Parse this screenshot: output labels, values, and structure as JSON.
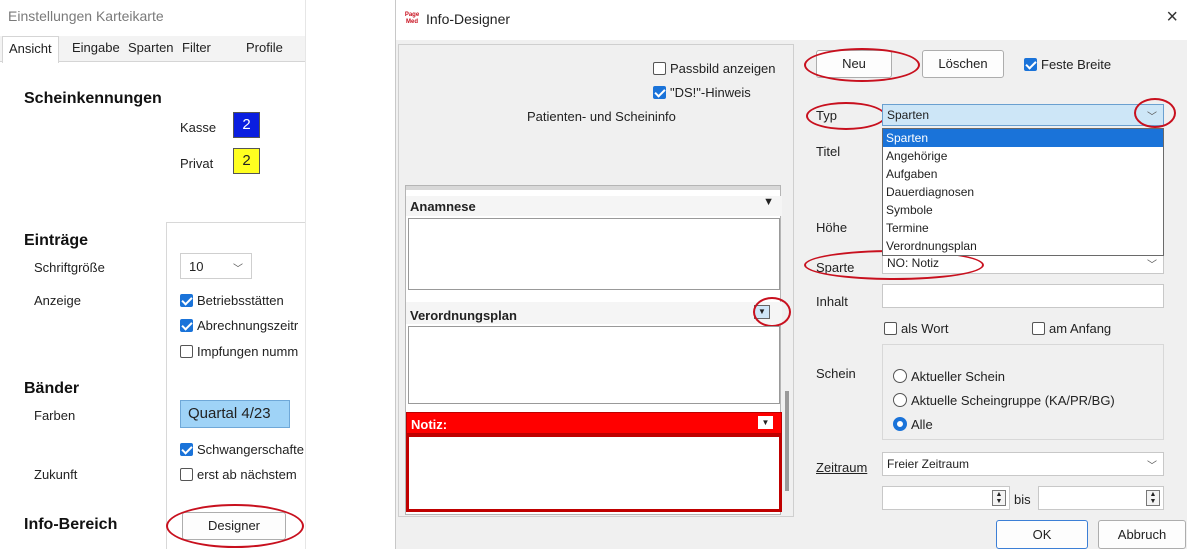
{
  "left_panel": {
    "title": "Einstellungen Karteikarte",
    "tabs": [
      "Ansicht",
      "Eingabe",
      "Sparten",
      "Filter",
      "Profile"
    ],
    "scheinkennungen": {
      "heading": "Scheinkennungen",
      "kasse_label": "Kasse",
      "kasse_value": "2",
      "kasse_color": "#0a1ee0",
      "privat_label": "Privat",
      "privat_value": "2",
      "privat_color": "#ffff20"
    },
    "eintraege": {
      "heading": "Einträge",
      "schriftgroesse_label": "Schriftgröße",
      "schriftgroesse_value": "10",
      "anzeige_label": "Anzeige",
      "options": [
        {
          "label": "Betriebsstätten",
          "checked": true
        },
        {
          "label": "Abrechnungszeitr",
          "checked": true
        },
        {
          "label": "Impfungen numm",
          "checked": false
        }
      ]
    },
    "baender": {
      "heading": "Bänder",
      "farben_label": "Farben",
      "quartal_label": "Quartal 4/23",
      "schwanger_label": "Schwangerschafte",
      "zukunft_label": "Zukunft",
      "erst_label": "erst ab nächstem"
    },
    "info_bereich": {
      "heading": "Info-Bereich",
      "designer_button": "Designer"
    }
  },
  "dialog": {
    "title": "Info-Designer",
    "app_icon_text": "Page Med",
    "close_symbol": "×",
    "preview": {
      "passbild_label": "Passbild anzeigen",
      "ds_label": "\"DS!\"-Hinweis",
      "patienten_label": "Patienten- und Scheininfo",
      "sections": [
        "Anamnese",
        "Verordnungsplan",
        "Notiz:"
      ],
      "notiz_color": "#ff0000"
    },
    "toolbar": {
      "neu": "Neu",
      "loeschen": "Löschen",
      "feste_breite": "Feste Breite"
    },
    "form": {
      "typ_label": "Typ",
      "typ_value": "Sparten",
      "typ_options": [
        "Sparten",
        "Angehörige",
        "Aufgaben",
        "Dauerdiagnosen",
        "Symbole",
        "Termine",
        "Verordnungsplan"
      ],
      "titel_label": "Titel",
      "hoehe_label": "Höhe",
      "sparte_label": "Sparte",
      "sparte_value": "NO: Notiz",
      "inhalt_label": "Inhalt",
      "als_wort": "als Wort",
      "am_anfang": "am Anfang",
      "schein_label": "Schein",
      "schein_options": [
        "Aktueller Schein",
        "Aktuelle Scheingruppe (KA/PR/BG)",
        "Alle"
      ],
      "zeitraum_label": "Zeitraum",
      "zeitraum_value": "Freier Zeitraum",
      "bis_label": "bis"
    },
    "buttons": {
      "ok": "OK",
      "abbruch": "Abbruch"
    }
  }
}
